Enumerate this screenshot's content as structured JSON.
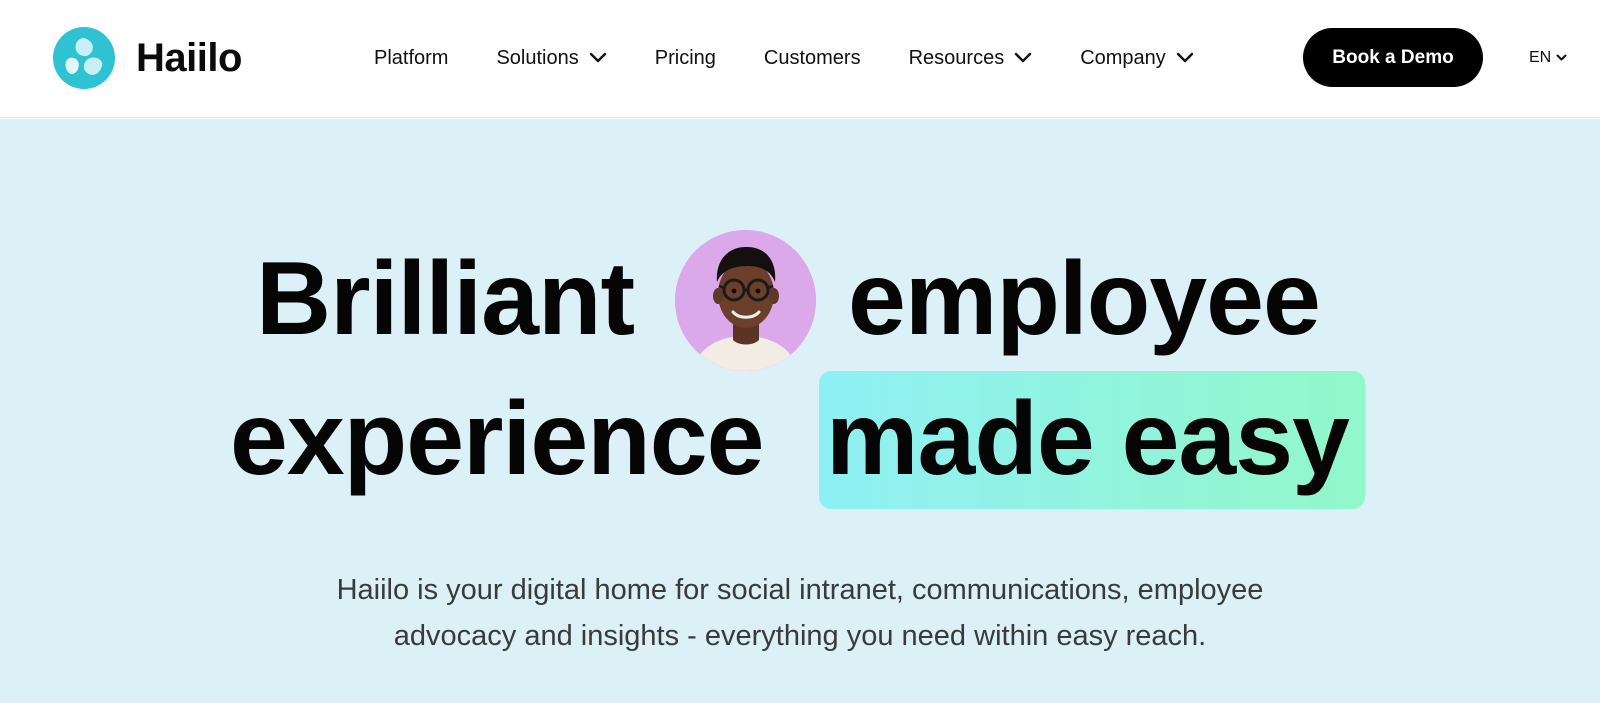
{
  "brand": {
    "name": "Haiilo",
    "colors": {
      "logo_teal": "#2fc2d2",
      "logo_light": "#bfeef3",
      "hero_bg": "#dcf0f7",
      "highlight_start": "#8ff0f4",
      "highlight_end": "#92f7c9",
      "avatar_bg": "#dba8ea"
    }
  },
  "nav": {
    "items": [
      {
        "label": "Platform",
        "has_dropdown": false
      },
      {
        "label": "Solutions",
        "has_dropdown": true
      },
      {
        "label": "Pricing",
        "has_dropdown": false
      },
      {
        "label": "Customers",
        "has_dropdown": false
      },
      {
        "label": "Resources",
        "has_dropdown": true
      },
      {
        "label": "Company",
        "has_dropdown": true
      }
    ],
    "cta_label": "Book a Demo",
    "language": "EN"
  },
  "hero": {
    "headline": {
      "word1": "Brilliant",
      "word2": "employee",
      "word3": "experience",
      "highlighted": "made easy"
    },
    "avatar_icon": "person-photo",
    "subtitle_line1": "Haiilo is your digital home for social intranet, communications, employee",
    "subtitle_line2": "advocacy and insights - everything you need within easy reach."
  }
}
